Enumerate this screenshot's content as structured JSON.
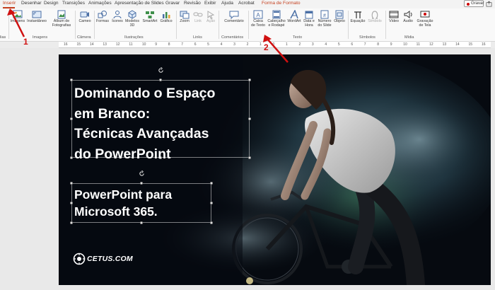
{
  "tabs": [
    {
      "label": "Inserir",
      "active": true
    },
    {
      "label": "Desenhar"
    },
    {
      "label": "Design"
    },
    {
      "label": "Transições"
    },
    {
      "label": "Animações"
    },
    {
      "label": "Apresentação de Slides"
    },
    {
      "label": "Gravar"
    },
    {
      "label": "Revisão"
    },
    {
      "label": "Exibir"
    },
    {
      "label": "Ajuda"
    },
    {
      "label": "Acrobat"
    },
    {
      "label": "Forma de Formato"
    }
  ],
  "record_button": {
    "label": "Gravar"
  },
  "ribbon": {
    "slides_group": "lias",
    "images": {
      "label": "Imagens",
      "label2": "Instantâneo",
      "album": "Álbum de",
      "album2": "Fotografias",
      "group": "Imagens"
    },
    "camera": {
      "label": "Cameo",
      "group": "Câmera"
    },
    "illustrations": {
      "shapes": "Formas",
      "icons": "Ícones",
      "models": "Modelos",
      "models2": "3D",
      "smartart": "SmartArt",
      "chart": "Gráfico",
      "group": "Ilustrações"
    },
    "links": {
      "zoom": "Zoom",
      "link": "Link",
      "action": "Ação",
      "group": "Links"
    },
    "comments": {
      "comment": "Comentário",
      "group": "Comentários"
    },
    "text": {
      "textbox": "Caixa",
      "textbox2": "de Texto",
      "header": "Cabeçalho",
      "header2": "e Rodapé",
      "wordart": "WordArt",
      "date": "Data e",
      "date2": "Hora",
      "slide_number": "Número",
      "slide_number2": "do Slide",
      "object": "Objeto",
      "group": "Texto"
    },
    "symbols": {
      "equation": "Equação",
      "symbol": "Símbolo",
      "group": "Símbolos"
    },
    "media": {
      "video": "Vídeo",
      "audio": "Áudio",
      "recording": "Gravação",
      "recording2": "de Tela",
      "group": "Mídia"
    }
  },
  "ruler_numbers": [
    "16",
    "15",
    "14",
    "13",
    "12",
    "11",
    "10",
    "9",
    "8",
    "7",
    "6",
    "5",
    "4",
    "3",
    "2",
    "1",
    "0",
    "1",
    "2",
    "3",
    "4",
    "5",
    "6",
    "7",
    "8",
    "9",
    "10",
    "11",
    "12",
    "13",
    "14",
    "15",
    "16"
  ],
  "slide": {
    "title_lines": [
      "Dominando o Espaço",
      "em Branco:",
      "Técnicas Avançadas",
      "do PowerPoint"
    ],
    "subtitle_lines": [
      "PowerPoint para",
      "Microsoft 365."
    ],
    "logo": "CETUS.COM"
  },
  "annotations": {
    "step1": "1",
    "step2": "2",
    "color": "#d01010"
  },
  "colors": {
    "accent": "#c43e1c",
    "slide_bg": "#070b12"
  }
}
